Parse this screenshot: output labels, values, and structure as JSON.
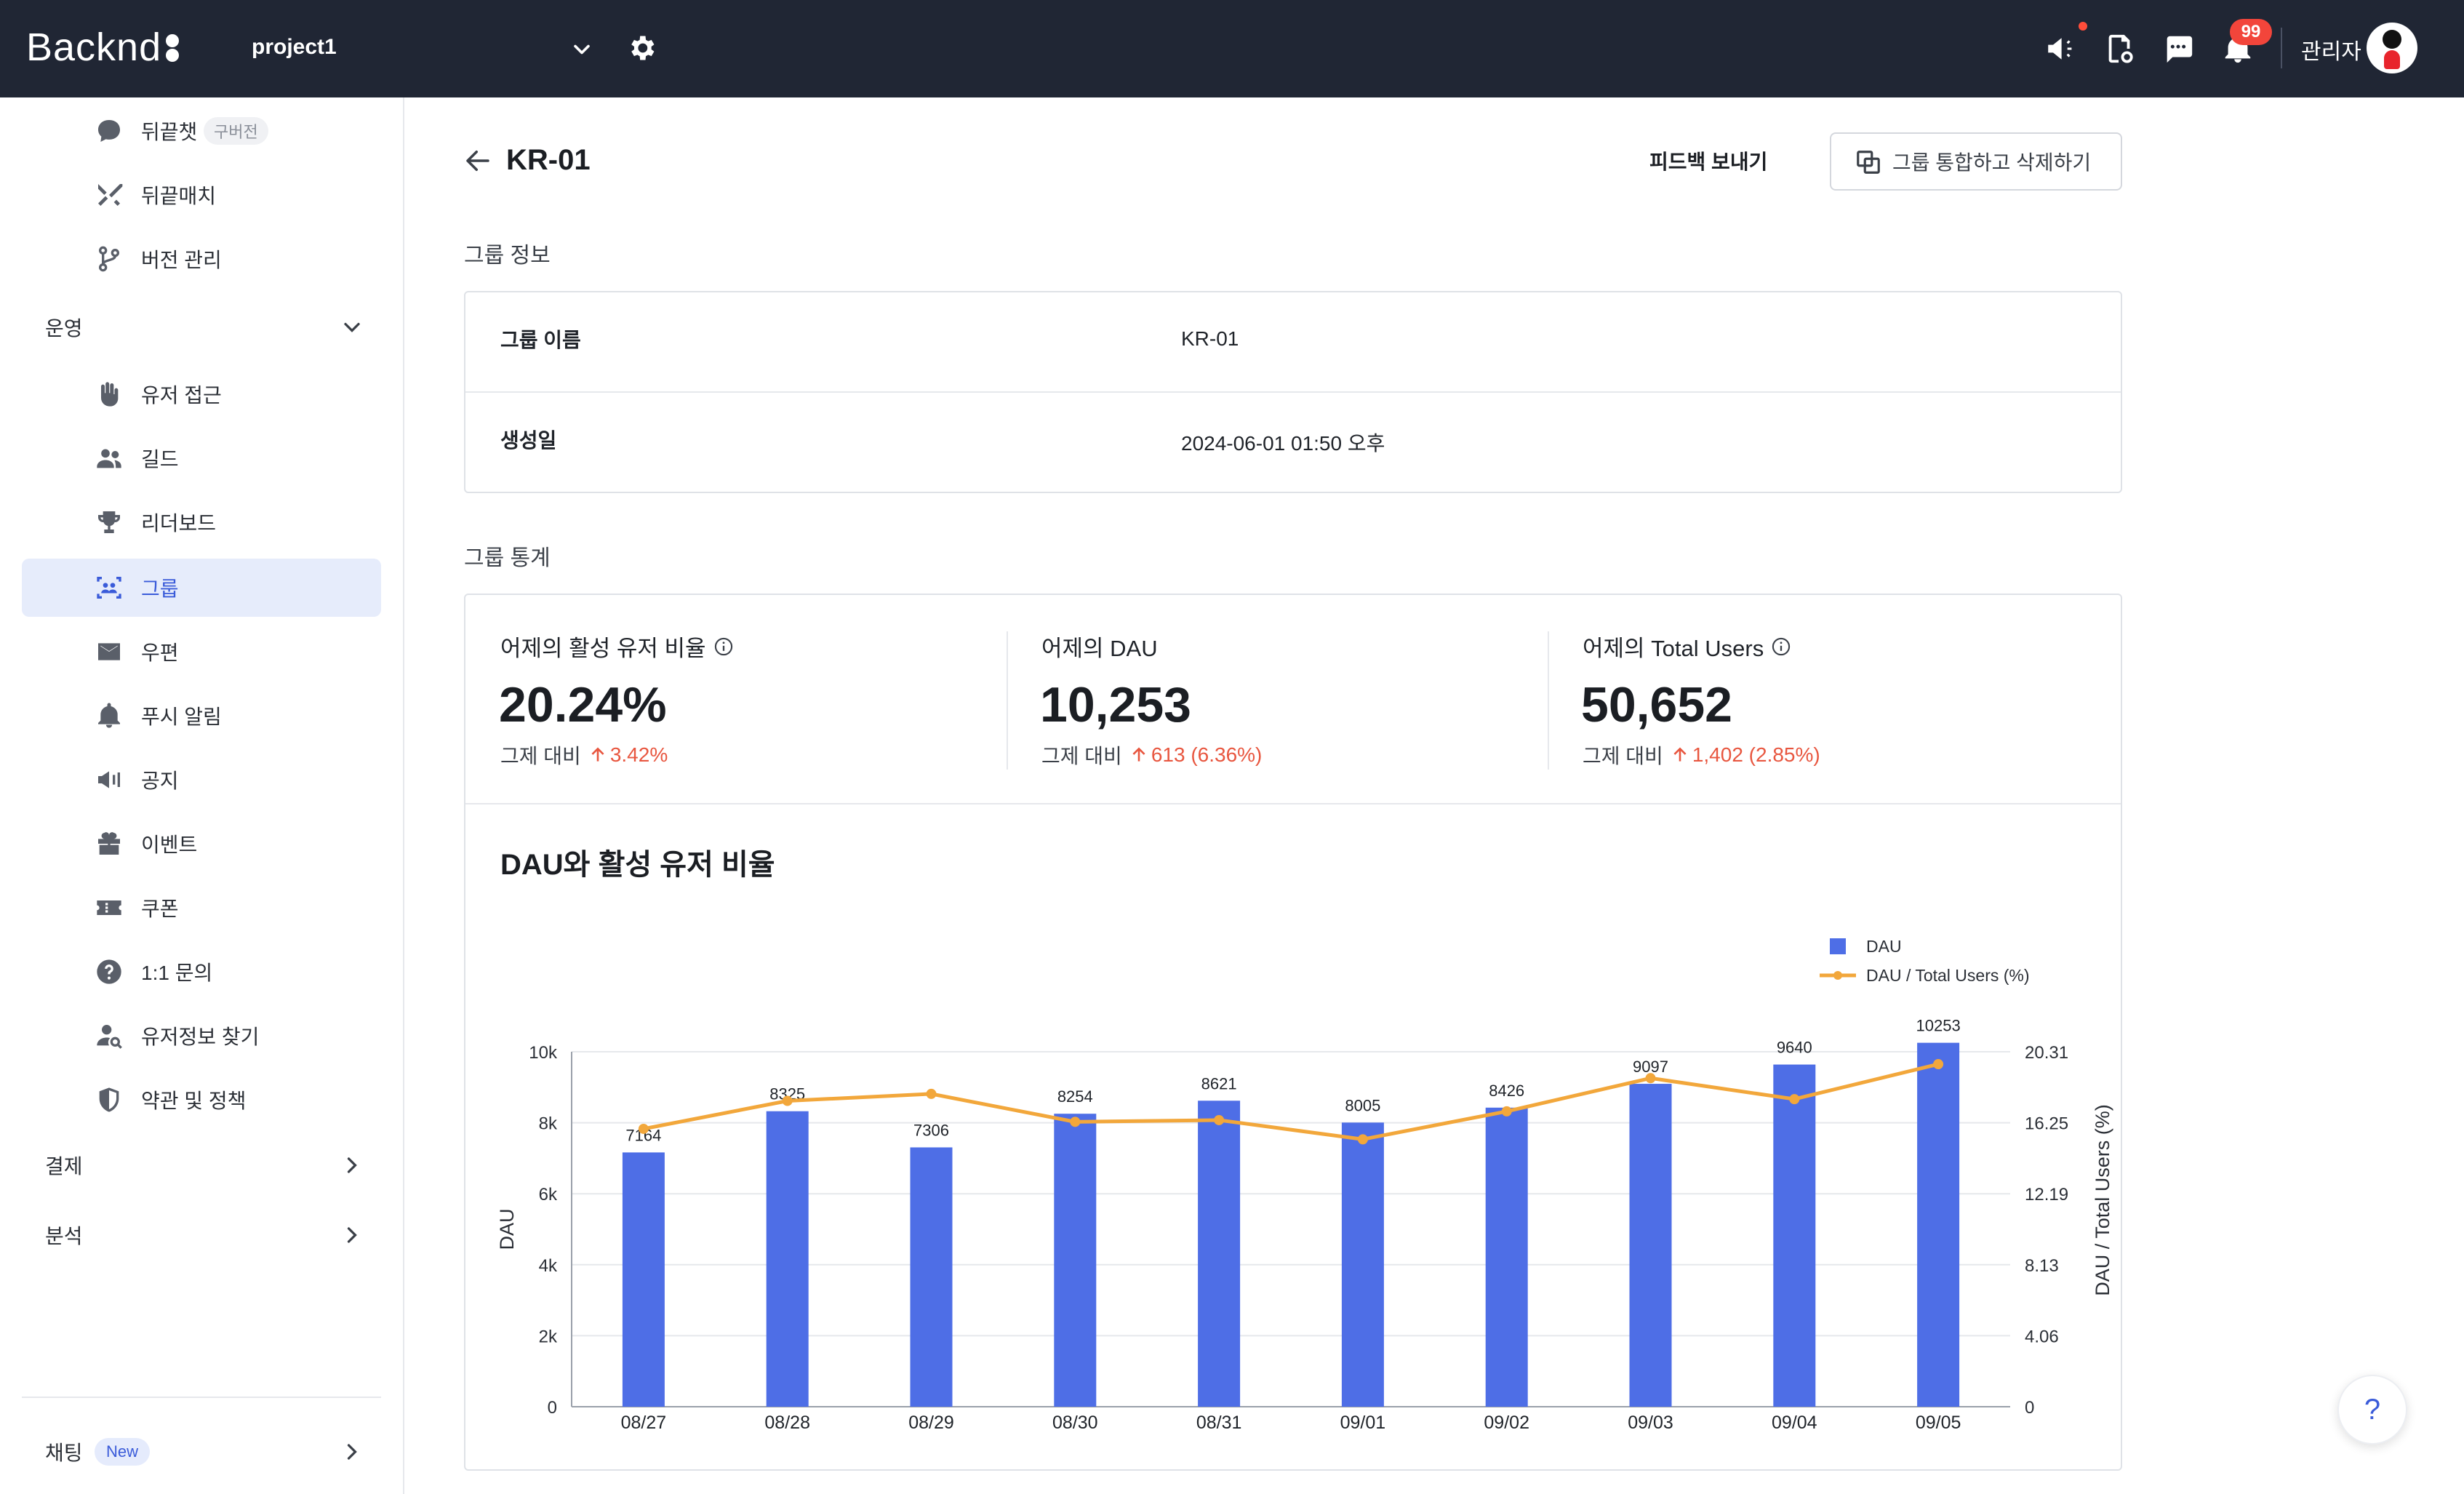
{
  "topbar": {
    "logo": "Backnd",
    "project": "project1",
    "notifications_count": "99",
    "admin": "관리자"
  },
  "sidebar": {
    "top_items": [
      {
        "label": "뒤끝챗",
        "tag": "구버전",
        "icon": "chat-icon"
      },
      {
        "label": "뒤끝매치",
        "icon": "swords-icon"
      },
      {
        "label": "버전 관리",
        "icon": "branch-icon"
      }
    ],
    "operation_section": "운영",
    "operation_items": [
      {
        "label": "유저 접근",
        "icon": "hand-icon"
      },
      {
        "label": "길드",
        "icon": "people-icon"
      },
      {
        "label": "리더보드",
        "icon": "trophy-icon"
      },
      {
        "label": "그룹",
        "icon": "group-scan-icon"
      },
      {
        "label": "우편",
        "icon": "mail-icon"
      },
      {
        "label": "푸시 알림",
        "icon": "bell-icon"
      },
      {
        "label": "공지",
        "icon": "megaphone-icon"
      },
      {
        "label": "이벤트",
        "icon": "gift-icon"
      },
      {
        "label": "쿠폰",
        "icon": "ticket-icon"
      },
      {
        "label": "1:1 문의",
        "icon": "question-icon"
      },
      {
        "label": "유저정보 찾기",
        "icon": "user-search-icon"
      },
      {
        "label": "약관 및 정책",
        "icon": "shield-icon"
      }
    ],
    "payment_section": "결제",
    "analytics_section": "분석",
    "chatting_section": "채팅",
    "chatting_tag": "New"
  },
  "page": {
    "title": "KR-01",
    "feedback": "피드백 보내기",
    "merge_delete": "그룹 통합하고 삭제하기"
  },
  "group_info": {
    "section_title": "그룹 정보",
    "rows": [
      {
        "key": "그룹 이름",
        "value": "KR-01"
      },
      {
        "key": "생성일",
        "value": "2024-06-01 01:50 오후"
      }
    ]
  },
  "group_stats": {
    "section_title": "그룹 통계",
    "cards": [
      {
        "label": "어제의 활성 유저 비율",
        "value": "20.24%",
        "compare_label": "그제 대비",
        "change": "3.42%"
      },
      {
        "label": "어제의 DAU",
        "value": "10,253",
        "compare_label": "그제 대비",
        "change": "613 (6.36%)"
      },
      {
        "label": "어제의 Total Users",
        "value": "50,652",
        "compare_label": "그제 대비",
        "change": "1,402 (2.85%)"
      }
    ]
  },
  "colors": {
    "bar": "#4e6ee6",
    "line": "#f2a73b",
    "accent": "#3a5bd9",
    "increase": "#e8563f"
  },
  "chart_data": {
    "type": "bar",
    "title": "DAU와 활성 유저 비율",
    "categories": [
      "08/27",
      "08/28",
      "08/29",
      "08/30",
      "08/31",
      "09/01",
      "09/02",
      "09/03",
      "09/04",
      "09/05"
    ],
    "series": [
      {
        "name": "DAU",
        "type": "bar",
        "axis": "left",
        "values": [
          7164,
          8325,
          7306,
          8254,
          8621,
          8005,
          8426,
          9097,
          9640,
          10253
        ]
      },
      {
        "name": "DAU / Total Users (%)",
        "type": "line",
        "axis": "right",
        "values": [
          15.9,
          17.5,
          17.9,
          16.3,
          16.4,
          15.3,
          16.9,
          18.8,
          17.6,
          19.6
        ]
      }
    ],
    "ylabel": "DAU",
    "ylabel_right": "DAU / Total Users (%)",
    "ylim": [
      0,
      10000
    ],
    "yticks": [
      "0",
      "2k",
      "4k",
      "6k",
      "8k",
      "10k"
    ],
    "ylim_right": [
      0,
      20.31
    ],
    "yticks_right": [
      "0",
      "4.06",
      "8.13",
      "12.19",
      "16.25",
      "20.31"
    ],
    "legend": "top-right",
    "grid": true
  },
  "help": "?"
}
